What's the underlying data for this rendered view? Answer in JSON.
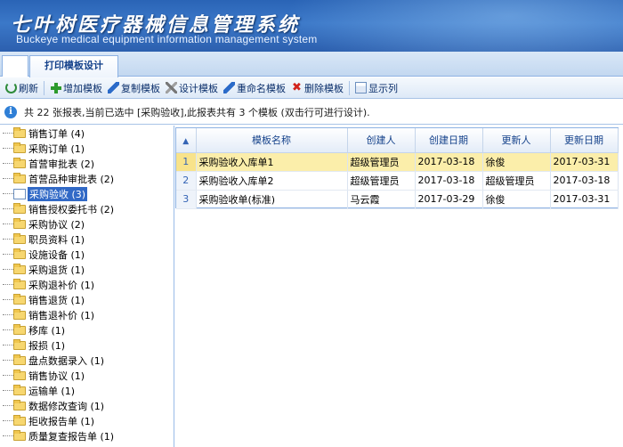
{
  "banner": {
    "title_cn": "七叶树医疗器械信息管理系统",
    "title_en": "Buckeye medical equipment information management system"
  },
  "tabs": [
    {
      "label": "打印模板设计",
      "active": true
    }
  ],
  "toolbar": {
    "refresh": "刷新",
    "add": "增加模板",
    "copy": "复制模板",
    "design": "设计模板",
    "rename": "重命名模板",
    "delete": "删除模板",
    "show_columns": "显示列"
  },
  "info": {
    "text": "共 22 张报表,当前已选中 [采购验收],此报表共有 3 个模板 (双击行可进行设计)."
  },
  "tree": {
    "items": [
      {
        "label": "销售订单 (4)"
      },
      {
        "label": "采购订单 (1)"
      },
      {
        "label": "首营审批表 (2)"
      },
      {
        "label": "首营品种审批表 (2)"
      },
      {
        "label": "采购验收 (3)",
        "selected": true
      },
      {
        "label": "销售授权委托书 (2)"
      },
      {
        "label": "采购协议 (2)"
      },
      {
        "label": "职员资料 (1)"
      },
      {
        "label": "设施设备 (1)"
      },
      {
        "label": "采购退货 (1)"
      },
      {
        "label": "采购退补价 (1)"
      },
      {
        "label": "销售退货 (1)"
      },
      {
        "label": "销售退补价 (1)"
      },
      {
        "label": "移库 (1)"
      },
      {
        "label": "报损 (1)"
      },
      {
        "label": "盘点数据录入 (1)"
      },
      {
        "label": "销售协议 (1)"
      },
      {
        "label": "运输单 (1)"
      },
      {
        "label": "数据修改查询 (1)"
      },
      {
        "label": "拒收报告单 (1)"
      },
      {
        "label": "质量复查报告单 (1)"
      }
    ]
  },
  "grid": {
    "sort_icon": "sort-icon",
    "columns": [
      "模板名称",
      "创建人",
      "创建日期",
      "更新人",
      "更新日期"
    ],
    "rows": [
      {
        "no": "1",
        "name": "采购验收入库单1",
        "creator": "超级管理员",
        "created": "2017-03-18",
        "updater": "徐俊",
        "updated": "2017-03-31",
        "highlight": true
      },
      {
        "no": "2",
        "name": "采购验收入库单2",
        "creator": "超级管理员",
        "created": "2017-03-18",
        "updater": "超级管理员",
        "updated": "2017-03-18"
      },
      {
        "no": "3",
        "name": "采购验收单(标准)",
        "creator": "马云霞",
        "created": "2017-03-29",
        "updater": "徐俊",
        "updated": "2017-03-31"
      }
    ]
  },
  "colors": {
    "banner": "#2c64b4",
    "selection": "#3169c6",
    "row_highlight": "#fbeeaa"
  }
}
